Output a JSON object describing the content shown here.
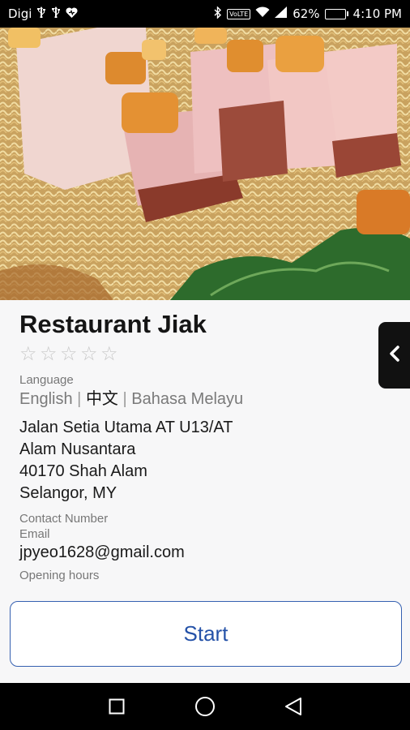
{
  "status_bar": {
    "carrier": "Digi",
    "battery_percent": "62%",
    "battery_level": 0.62,
    "time": "4:10 PM",
    "volte": "VoLTE",
    "left_icons": [
      "usb-icon",
      "usb-icon",
      "heart-icon"
    ],
    "right_icons": [
      "bluetooth-icon",
      "volte-icon",
      "wifi-icon",
      "signal-icon",
      "battery-icon"
    ]
  },
  "hero": {
    "subject": "noodles with roast pork"
  },
  "restaurant": {
    "name": "Restaurant Jiak",
    "rating": 0,
    "max_rating": 5
  },
  "language": {
    "label": "Language",
    "options": [
      "English",
      "中文",
      "Bahasa Melayu"
    ],
    "separator": "|",
    "selected": "中文"
  },
  "address": {
    "line1": "Jalan Setia Utama AT U13/AT",
    "line2": "Alam Nusantara",
    "line3": "40170 Shah Alam",
    "line4": "Selangor, MY"
  },
  "contact": {
    "number_label": "Contact Number",
    "email_label": "Email",
    "email": "jpyeo1628@gmail.com",
    "opening_label": "Opening hours"
  },
  "actions": {
    "start_label": "Start"
  },
  "colors": {
    "accent": "#2552a8",
    "battery": "#44d13c"
  }
}
